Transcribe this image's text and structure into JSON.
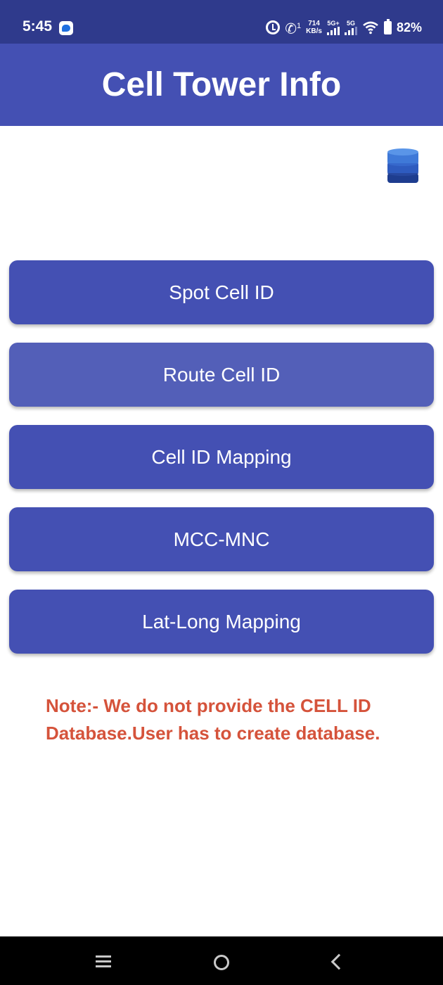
{
  "status_bar": {
    "time": "5:45",
    "call_indicator": "1",
    "speed_value": "714",
    "speed_unit": "KB/s",
    "sim1_label": "5G+",
    "sim2_label": "5G",
    "battery_percent": "82%",
    "icons": [
      "messenger-icon",
      "alarm-icon",
      "wifi-call-icon",
      "signal-icon",
      "wifi-icon",
      "battery-icon"
    ]
  },
  "app_bar": {
    "title": "Cell Tower Info"
  },
  "toolbar": {
    "database_icon": "database-icon"
  },
  "menu": {
    "spot_cell_id": "Spot Cell ID",
    "route_cell_id": "Route Cell ID",
    "cell_id_mapping": "Cell ID Mapping",
    "mcc_mnc": "MCC-MNC",
    "lat_long_mapping": "Lat-Long Mapping"
  },
  "note": "Note:- We do not provide the CELL ID Database.User has to create database.",
  "colors": {
    "status_bar": "#2f3a8c",
    "primary": "#4450b3",
    "button_pressed": "#535fb8",
    "note_text": "#d5533b",
    "nav_bar": "#000000"
  },
  "nav_bar": {
    "icons": [
      "recents-icon",
      "home-icon",
      "back-icon"
    ]
  }
}
